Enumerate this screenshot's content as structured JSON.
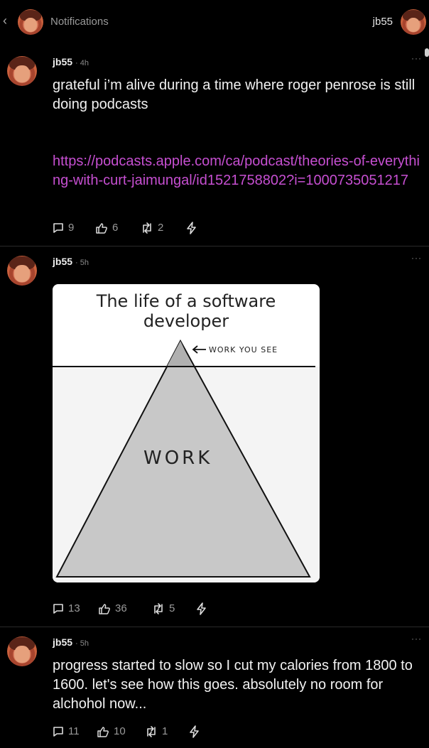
{
  "header": {
    "title": "Notifications",
    "username": "jb55"
  },
  "posts": [
    {
      "author": "jb55",
      "time": "· 4h",
      "text": "grateful i’m alive during a time where roger penrose is still doing podcasts",
      "link": "https://podcasts.apple.com/ca/podcast/theories-of-everything-with-curt-jaimungal/id1521758802?i=1000735051217",
      "replies": "9",
      "likes": "6",
      "reposts": "2"
    },
    {
      "author": "jb55",
      "time": "· 5h",
      "image": {
        "title": "The life of a software developer",
        "label_big": "WORK",
        "label_small": "WORK YOU SEE"
      },
      "replies": "13",
      "likes": "36",
      "reposts": "5"
    },
    {
      "author": "jb55",
      "time": "· 5h",
      "text": "progress started to slow so I cut my calories from 1800 to 1600. let's see how this goes. absolutely no room for alchohol now...",
      "replies": "11",
      "likes": "10",
      "reposts": "1"
    }
  ],
  "icons": {
    "back": "chevron-left-icon",
    "reply": "comment-icon",
    "like": "like-icon",
    "repost": "repost-icon",
    "zap": "lightning-icon"
  },
  "colors": {
    "link": "#c64fd1",
    "background": "#000000"
  }
}
